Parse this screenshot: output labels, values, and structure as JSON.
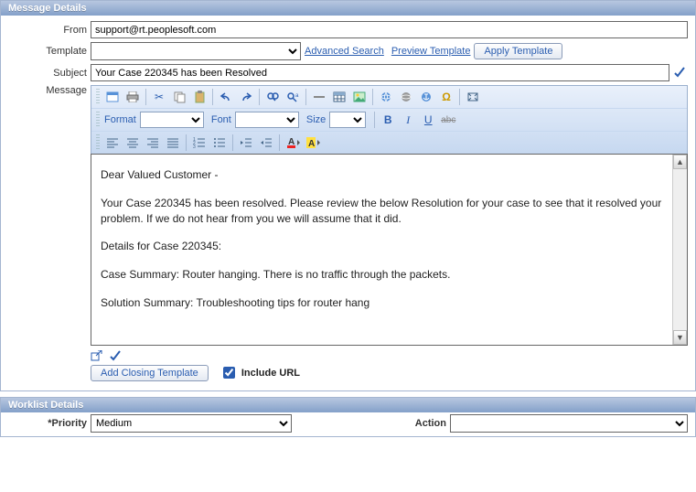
{
  "panels": {
    "message": {
      "title": "Message Details"
    },
    "worklist": {
      "title": "Worklist Details"
    }
  },
  "labels": {
    "from": "From",
    "template": "Template",
    "subject": "Subject",
    "message": "Message",
    "priority": "*Priority",
    "action": "Action"
  },
  "from_value": "support@rt.peoplesoft.com",
  "template_value": "",
  "subject_value": "Your Case 220345 has been Resolved",
  "links": {
    "adv_search": "Advanced Search",
    "preview": "Preview Template"
  },
  "buttons": {
    "apply_template": "Apply Template",
    "add_closing": "Add Closing Template"
  },
  "include_url": {
    "label": "Include URL",
    "checked": true
  },
  "rte": {
    "format_label": "Format",
    "font_label": "Font",
    "size_label": "Size",
    "format_value": "",
    "font_value": "",
    "size_value": ""
  },
  "message_body": {
    "p1": "Dear Valued Customer -",
    "p2": "Your Case 220345 has been resolved.  Please review the below Resolution for your case to see that it resolved your problem.  If we do not hear from you we will assume that it did.",
    "p3": "Details for Case 220345:",
    "p4": "Case Summary: Router hanging.  There is no traffic through the packets.",
    "p5": "Solution Summary: Troubleshooting tips for router hang"
  },
  "worklist": {
    "priority_value": "Medium",
    "action_value": ""
  }
}
